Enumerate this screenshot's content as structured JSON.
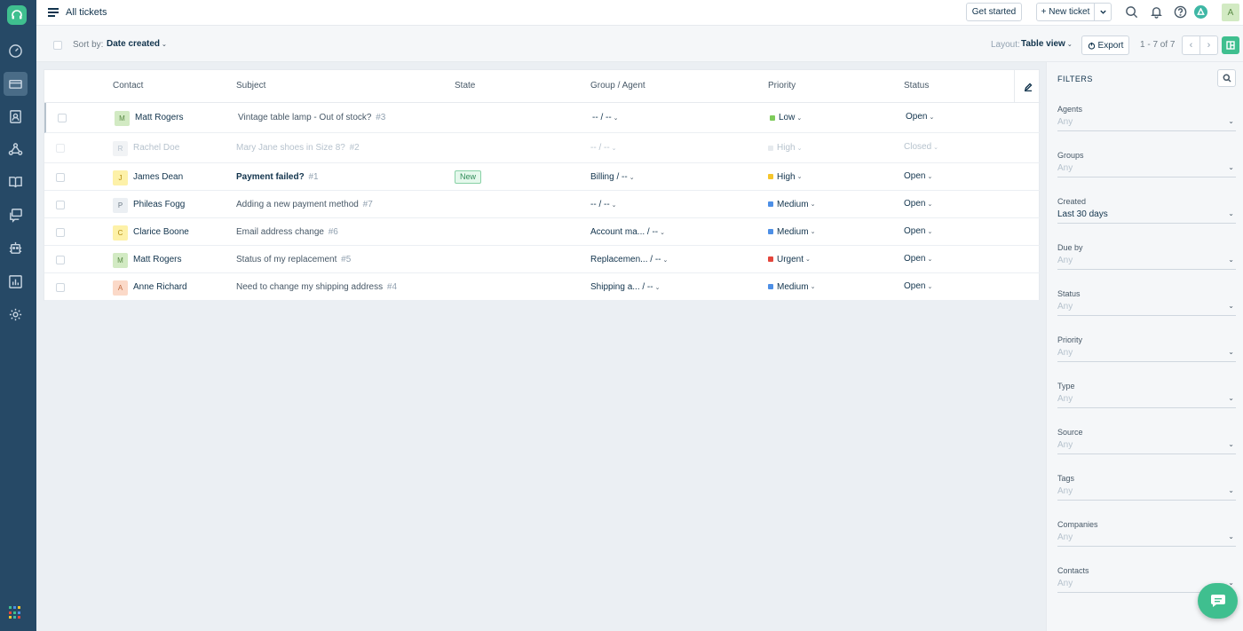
{
  "header": {
    "title": "All tickets",
    "get_started_label": "Get started",
    "new_ticket_label": "+ New ticket",
    "avatar_initial": "A"
  },
  "toolbar": {
    "sort_label": "Sort by:",
    "sort_value": "Date created",
    "layout_label": "Layout:",
    "layout_value": "Table view",
    "export_label": "Export",
    "pager_text": "1 - 7 of 7"
  },
  "table": {
    "columns": [
      "Contact",
      "Subject",
      "State",
      "Group / Agent",
      "Priority",
      "Status"
    ],
    "rows": [
      {
        "initial": "M",
        "contact": "Matt Rogers",
        "subject": "Vintage table lamp - Out of stock?",
        "number": "#3",
        "state": "",
        "group": "-- / --",
        "priority": "Low",
        "priority_color": "#7ecb5b",
        "status": "Open",
        "avatar_bg": "#d2eac3",
        "avatar_fg": "#5a8b45"
      },
      {
        "initial": "R",
        "contact": "Rachel Doe",
        "subject": "Mary Jane shoes in Size 8?",
        "number": "#2",
        "state": "",
        "group": "-- / --",
        "priority": "High",
        "priority_color": "#e6eaee",
        "status": "Closed",
        "avatar_bg": "#f1f3f5",
        "avatar_fg": "#b6c2cd"
      },
      {
        "initial": "J",
        "contact": "James Dean",
        "subject": "Payment failed?",
        "number": "#1",
        "state": "New",
        "group": "Billing / --",
        "priority": "High",
        "priority_color": "#f5c52b",
        "status": "Open",
        "avatar_bg": "#fdf1a8",
        "avatar_fg": "#b28a0f"
      },
      {
        "initial": "P",
        "contact": "Phileas Fogg",
        "subject": "Adding a new payment method",
        "number": "#7",
        "state": "",
        "group": "-- / --",
        "priority": "Medium",
        "priority_color": "#4d8fe6",
        "status": "Open",
        "avatar_bg": "#ebeff3",
        "avatar_fg": "#6f7c87"
      },
      {
        "initial": "C",
        "contact": "Clarice Boone",
        "subject": "Email address change",
        "number": "#6",
        "state": "",
        "group": "Account ma... / --",
        "priority": "Medium",
        "priority_color": "#4d8fe6",
        "status": "Open",
        "avatar_bg": "#fdf1a8",
        "avatar_fg": "#b28a0f"
      },
      {
        "initial": "M",
        "contact": "Matt Rogers",
        "subject": "Status of my replacement",
        "number": "#5",
        "state": "",
        "group": "Replacemen... / --",
        "priority": "Urgent",
        "priority_color": "#e4463c",
        "status": "Open",
        "avatar_bg": "#d2eac3",
        "avatar_fg": "#5a8b45"
      },
      {
        "initial": "A",
        "contact": "Anne Richard",
        "subject": "Need to change my shipping address",
        "number": "#4",
        "state": "",
        "group": "Shipping a... / --",
        "priority": "Medium",
        "priority_color": "#4d8fe6",
        "status": "Open",
        "avatar_bg": "#fbd9c8",
        "avatar_fg": "#c0693f"
      }
    ]
  },
  "filters": {
    "title": "FILTERS",
    "items": [
      {
        "label": "Agents",
        "value": "Any"
      },
      {
        "label": "Groups",
        "value": "Any"
      },
      {
        "label": "Created",
        "value": "Last 30 days"
      },
      {
        "label": "Due by",
        "value": "Any"
      },
      {
        "label": "Status",
        "value": "Any"
      },
      {
        "label": "Priority",
        "value": "Any"
      },
      {
        "label": "Type",
        "value": "Any"
      },
      {
        "label": "Source",
        "value": "Any"
      },
      {
        "label": "Tags",
        "value": "Any"
      },
      {
        "label": "Companies",
        "value": "Any"
      },
      {
        "label": "Contacts",
        "value": "Any"
      }
    ]
  },
  "colors": {
    "brand": "#3fbf8f",
    "nav_bg": "#264966"
  },
  "icons": [
    "headset-logo-icon",
    "dashboard-icon",
    "tickets-icon",
    "contacts-icon",
    "groups-icon",
    "knowledge-base-icon",
    "forums-icon",
    "bots-icon",
    "reports-icon",
    "settings-icon",
    "apps-grid-icon",
    "search-icon",
    "bell-icon",
    "help-icon",
    "freddy-icon",
    "export-icon",
    "edit-icon",
    "chat-icon"
  ]
}
